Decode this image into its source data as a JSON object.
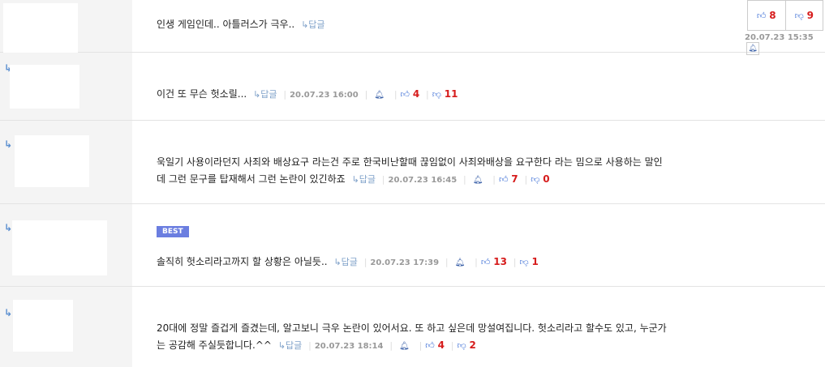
{
  "reply_label": "답글",
  "comments": [
    {
      "text": "인생 게임인데.. 아틀러스가 극우..",
      "date": "20.07.23 15:35",
      "up": "8",
      "down": "9"
    },
    {
      "text": "이건 또 무슨  헛소릴...",
      "date": "20.07.23 16:00",
      "up": "4",
      "down": "11"
    },
    {
      "text_line1": "욱일기 사용이라던지 사죄와 배상요구 라는건 주로 한국비난할때 끊임없이 사죄와배상을 요구한다 라는 밈으로 사용하는 말인",
      "text_line2": "데 그런 문구를 탑재해서 그런 논란이 있긴하죠",
      "date": "20.07.23 16:45",
      "up": "7",
      "down": "0"
    },
    {
      "badge": "BEST",
      "text": "솔직히 헛소리라고까지 할 상황은 아닐듯..",
      "date": "20.07.23 17:39",
      "up": "13",
      "down": "1"
    },
    {
      "text_line1": "20대에 정말 즐겁게 즐겼는데, 알고보니 극우 논란이 있어서요. 또 하고 싶은데 망설여집니다. 헛소리라고 할수도 있고, 누군가",
      "text_line2": "는 공감해 주실듯합니다.^^",
      "date": "20.07.23 18:14",
      "up": "4",
      "down": "2"
    }
  ]
}
